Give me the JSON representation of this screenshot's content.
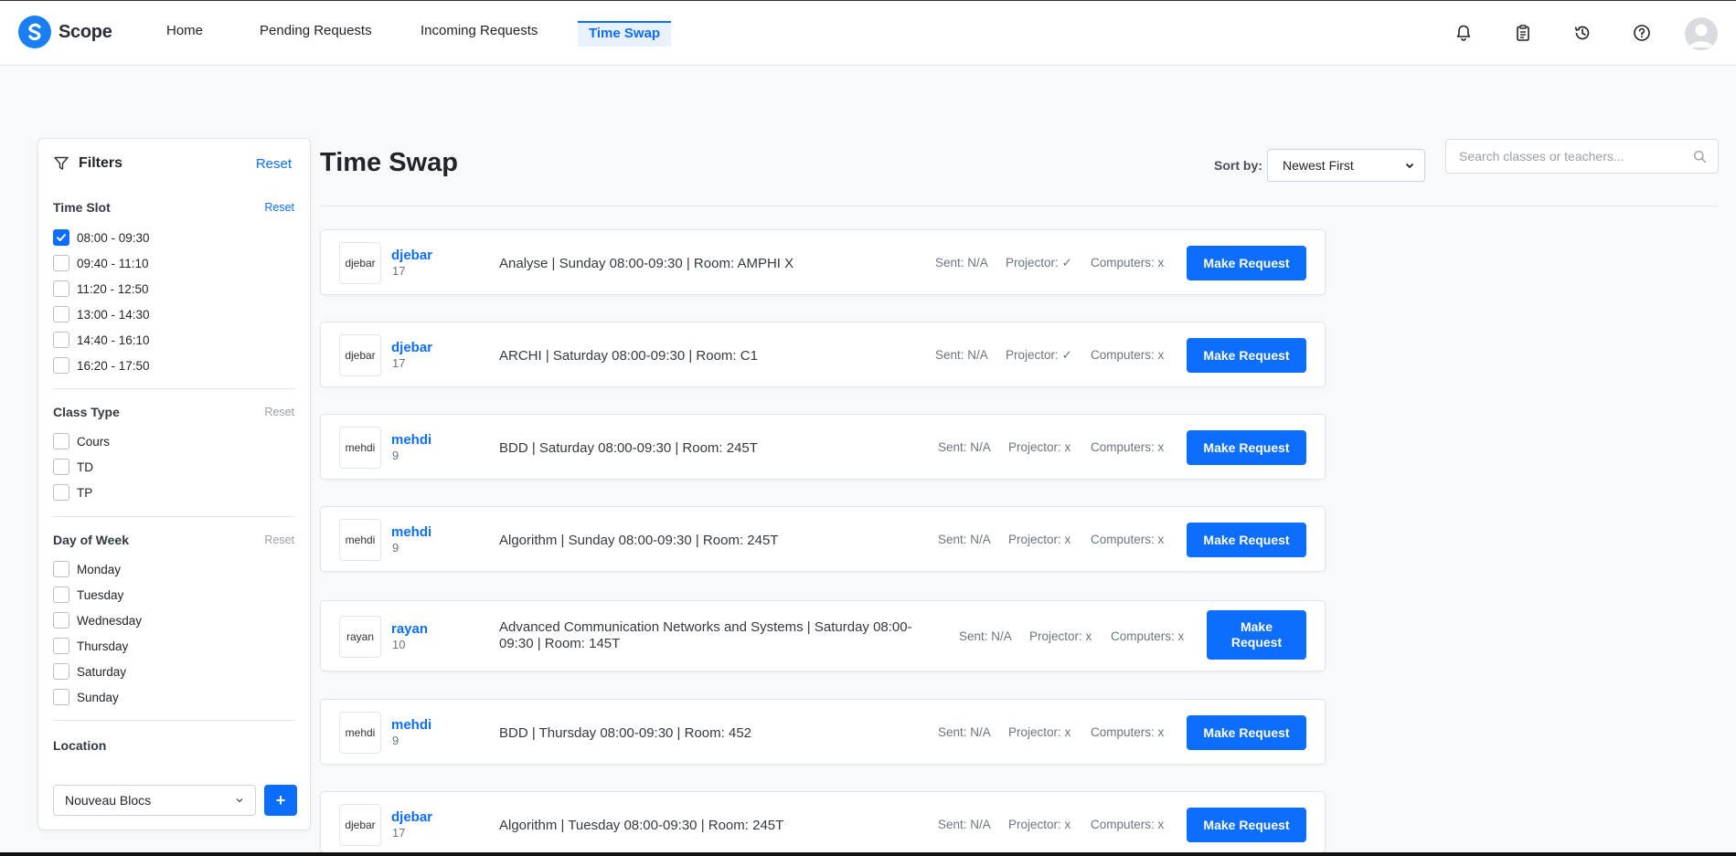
{
  "nav": {
    "brand": "Scope",
    "links": [
      "Home",
      "Pending Requests",
      "Incoming Requests",
      "Time Swap"
    ],
    "active": "Time Swap",
    "accent": "#0d6efd"
  },
  "filters": {
    "title": "Filters",
    "reset": "Reset",
    "time_slot": {
      "title": "Time Slot",
      "reset": "Reset",
      "items": [
        {
          "label": "08:00 - 09:30",
          "checked": true
        },
        {
          "label": "09:40 - 11:10",
          "checked": false
        },
        {
          "label": "11:20 - 12:50",
          "checked": false
        },
        {
          "label": "13:00 - 14:30",
          "checked": false
        },
        {
          "label": "14:40 - 16:10",
          "checked": false
        },
        {
          "label": "16:20 - 17:50",
          "checked": false
        }
      ]
    },
    "class_type": {
      "title": "Class Type",
      "reset": "Reset",
      "items": [
        "Cours",
        "TD",
        "TP"
      ]
    },
    "day_of_week": {
      "title": "Day of Week",
      "reset": "Reset",
      "items": [
        "Monday",
        "Tuesday",
        "Wednesday",
        "Thursday",
        "Saturday",
        "Sunday"
      ]
    },
    "location": {
      "title": "Location",
      "selected": "Nouveau Blocs",
      "add": "+"
    }
  },
  "main": {
    "title": "Time Swap",
    "sort_label": "Sort by:",
    "sort_value": "Newest First",
    "search_placeholder": "Search classes or teachers..."
  },
  "cards": [
    {
      "name": "djebar",
      "count": "17",
      "avatar_alt": "djebar",
      "desc": "Analyse | Sunday 08:00-09:30 | Room: AMPHI X",
      "sent": "Sent: N/A",
      "projector": "Projector: ✓",
      "computers": "Computers: x",
      "button": "Make Request"
    },
    {
      "name": "djebar",
      "count": "17",
      "avatar_alt": "djebar",
      "desc": "ARCHI | Saturday 08:00-09:30 | Room: C1",
      "sent": "Sent: N/A",
      "projector": "Projector: ✓",
      "computers": "Computers: x",
      "button": "Make Request"
    },
    {
      "name": "mehdi",
      "count": "9",
      "avatar_alt": "mehdi",
      "desc": "BDD | Saturday 08:00-09:30 | Room: 245T",
      "sent": "Sent: N/A",
      "projector": "Projector: x",
      "computers": "Computers: x",
      "button": "Make Request"
    },
    {
      "name": "mehdi",
      "count": "9",
      "avatar_alt": "mehdi",
      "desc": "Algorithm | Sunday 08:00-09:30 | Room: 245T",
      "sent": "Sent: N/A",
      "projector": "Projector: x",
      "computers": "Computers: x",
      "button": "Make Request"
    },
    {
      "name": "rayan",
      "count": "10",
      "avatar_alt": "rayan",
      "desc": "Advanced Communication Networks and Systems | Saturday 08:00-09:30 | Room: 145T",
      "sent": "Sent: N/A",
      "projector": "Projector: x",
      "computers": "Computers: x",
      "button": "Make Request"
    },
    {
      "name": "mehdi",
      "count": "9",
      "avatar_alt": "mehdi",
      "desc": "BDD | Thursday 08:00-09:30 | Room: 452",
      "sent": "Sent: N/A",
      "projector": "Projector: x",
      "computers": "Computers: x",
      "button": "Make Request"
    },
    {
      "name": "djebar",
      "count": "17",
      "avatar_alt": "djebar",
      "desc": "Algorithm | Tuesday 08:00-09:30 | Room: 245T",
      "sent": "Sent: N/A",
      "projector": "Projector: x",
      "computers": "Computers: x",
      "button": "Make Request"
    }
  ]
}
